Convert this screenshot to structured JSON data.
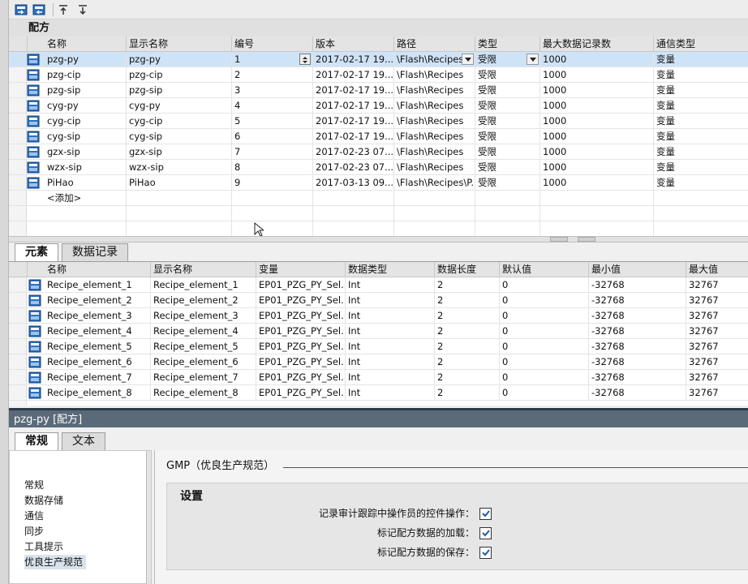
{
  "recipes": {
    "section_title": "配方",
    "columns": [
      "名称",
      "显示名称",
      "编号",
      "版本",
      "路径",
      "类型",
      "最大数据记录数",
      "通信类型"
    ],
    "rows": [
      [
        "pzg-py",
        "pzg-py",
        "1",
        "2017-02-17 19...",
        "\\Flash\\Recipes",
        "受限",
        "1000",
        "变量"
      ],
      [
        "pzg-cip",
        "pzg-cip",
        "2",
        "2017-02-17 19...",
        "\\Flash\\Recipes",
        "受限",
        "1000",
        "变量"
      ],
      [
        "pzg-sip",
        "pzg-sip",
        "3",
        "2017-02-17 19...",
        "\\Flash\\Recipes",
        "受限",
        "1000",
        "变量"
      ],
      [
        "cyg-py",
        "cyg-py",
        "4",
        "2017-02-17 19...",
        "\\Flash\\Recipes",
        "受限",
        "1000",
        "变量"
      ],
      [
        "cyg-cip",
        "cyg-cip",
        "5",
        "2017-02-17 19...",
        "\\Flash\\Recipes",
        "受限",
        "1000",
        "变量"
      ],
      [
        "cyg-sip",
        "cyg-sip",
        "6",
        "2017-02-17 19...",
        "\\Flash\\Recipes",
        "受限",
        "1000",
        "变量"
      ],
      [
        "gzx-sip",
        "gzx-sip",
        "7",
        "2017-02-23 07...",
        "\\Flash\\Recipes",
        "受限",
        "1000",
        "变量"
      ],
      [
        "wzx-sip",
        "wzx-sip",
        "8",
        "2017-02-23 07...",
        "\\Flash\\Recipes",
        "受限",
        "1000",
        "变量"
      ],
      [
        "PiHao",
        "PiHao",
        "9",
        "2017-03-13 09...",
        "\\Flash\\Recipes\\P...",
        "受限",
        "1000",
        "变量"
      ]
    ],
    "add_label": "<添加>"
  },
  "elements": {
    "tabs": [
      "元素",
      "数据记录"
    ],
    "columns": [
      "名称",
      "显示名称",
      "变量",
      "数据类型",
      "数据长度",
      "默认值",
      "最小值",
      "最大值"
    ],
    "rows": [
      [
        "Recipe_element_1",
        "Recipe_element_1",
        "EP01_PZG_PY_Sel...",
        "Int",
        "2",
        "0",
        "-32768",
        "32767"
      ],
      [
        "Recipe_element_2",
        "Recipe_element_2",
        "EP01_PZG_PY_Sel...",
        "Int",
        "2",
        "0",
        "-32768",
        "32767"
      ],
      [
        "Recipe_element_3",
        "Recipe_element_3",
        "EP01_PZG_PY_Sel...",
        "Int",
        "2",
        "0",
        "-32768",
        "32767"
      ],
      [
        "Recipe_element_4",
        "Recipe_element_4",
        "EP01_PZG_PY_Sel...",
        "Int",
        "2",
        "0",
        "-32768",
        "32767"
      ],
      [
        "Recipe_element_5",
        "Recipe_element_5",
        "EP01_PZG_PY_Sel...",
        "Int",
        "2",
        "0",
        "-32768",
        "32767"
      ],
      [
        "Recipe_element_6",
        "Recipe_element_6",
        "EP01_PZG_PY_Sel...",
        "Int",
        "2",
        "0",
        "-32768",
        "32767"
      ],
      [
        "Recipe_element_7",
        "Recipe_element_7",
        "EP01_PZG_PY_Sel...",
        "Int",
        "2",
        "0",
        "-32768",
        "32767"
      ],
      [
        "Recipe_element_8",
        "Recipe_element_8",
        "EP01_PZG_PY_Sel...",
        "Int",
        "2",
        "0",
        "-32768",
        "32767"
      ]
    ]
  },
  "properties": {
    "title": "pzg-py [配方]",
    "tabs": [
      "常规",
      "文本"
    ],
    "nav": [
      "常规",
      "数据存储",
      "通信",
      "同步",
      "工具提示",
      "优良生产规范"
    ],
    "gmp_title": "GMP（优良生产规范）",
    "settings_title": "设置",
    "checks": [
      {
        "label": "记录审计跟踪中操作员的控件操作：",
        "checked": true
      },
      {
        "label": "标记配方数据的加载：",
        "checked": true
      },
      {
        "label": "标记配方数据的保存：",
        "checked": true
      }
    ]
  },
  "colors": {
    "selection": "#cfe3f6",
    "icon_blue": "#1f5fb0",
    "props_header": "#5a6a78"
  }
}
